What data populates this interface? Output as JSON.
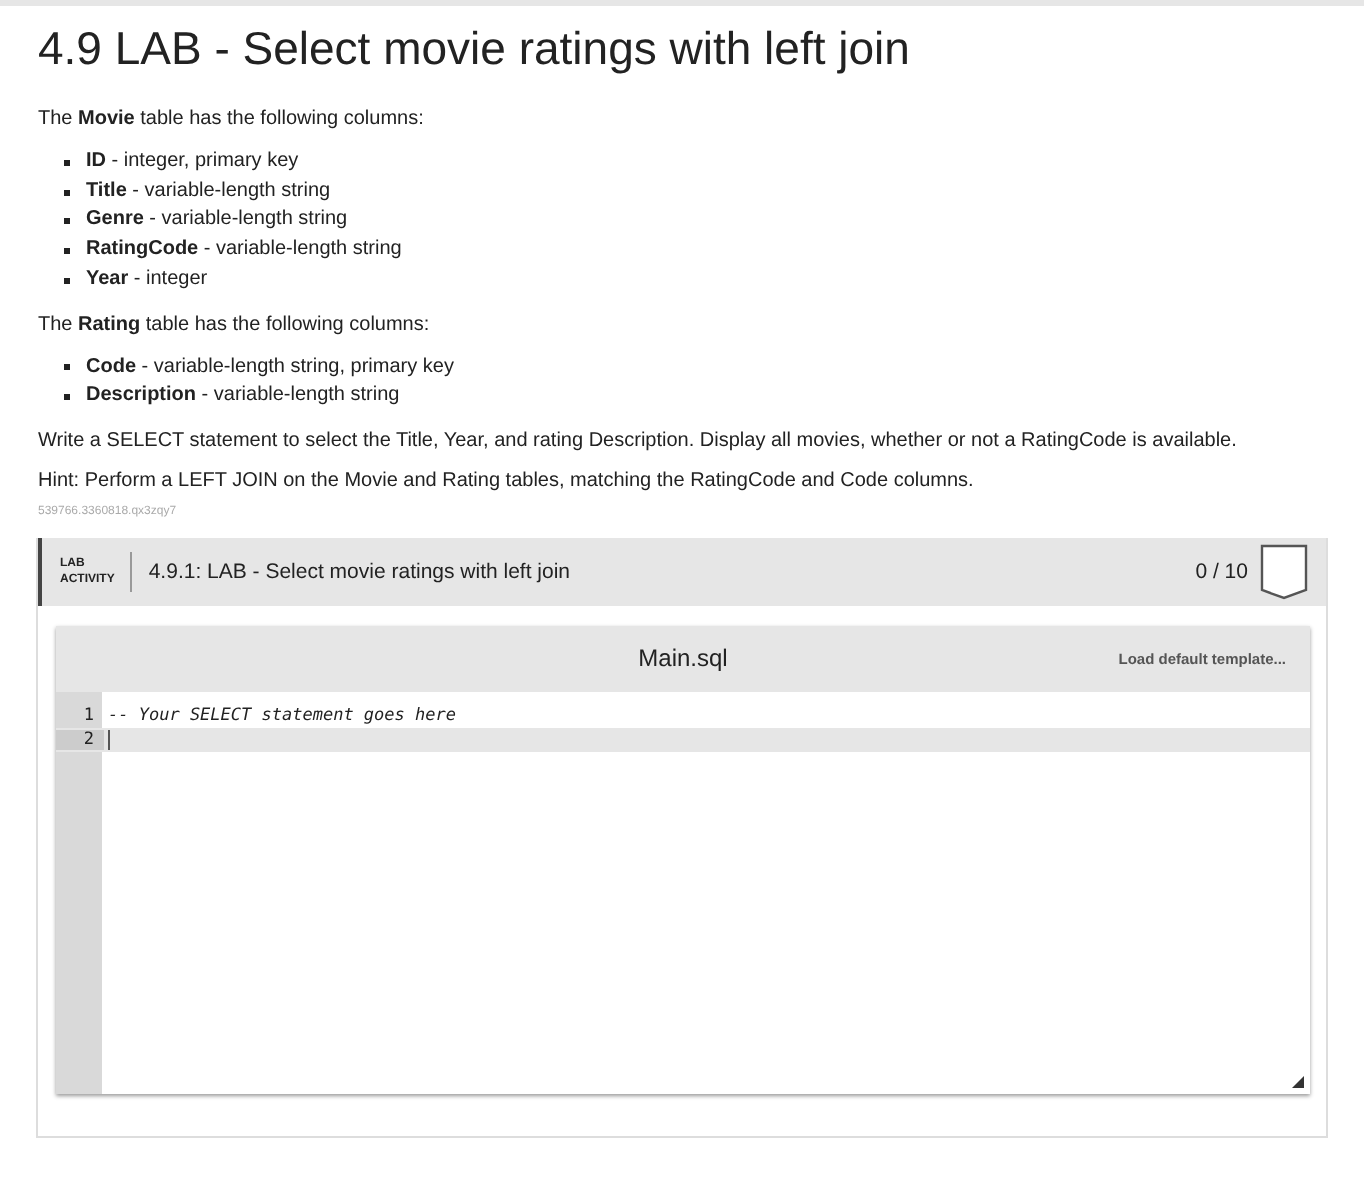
{
  "title": "4.9 LAB - Select movie ratings with left join",
  "sections": [
    {
      "intro": "The **Movie** table has the following columns:",
      "columns": [
        {
          "name": "ID",
          "description": " - integer, primary key"
        },
        {
          "name": "Title",
          "description": " - variable-length string"
        },
        {
          "name": "Genre",
          "description": " - variable-length string"
        },
        {
          "name": "RatingCode",
          "description": " - variable-length string"
        },
        {
          "name": "Year",
          "description": " - integer"
        }
      ]
    },
    {
      "intro": "The **Rating** table has the following columns:",
      "columns": [
        {
          "name": "Code",
          "description": " - variable-length string, primary key"
        },
        {
          "name": "Description",
          "description": " - variable-length string"
        }
      ]
    }
  ],
  "instructions": "Write a SELECT statement to select the Title, Year, and rating Description. Display all movies, whether or not a RatingCode is available.",
  "hint": "Hint: Perform a LEFT JOIN on the Movie and Rating tables, matching the RatingCode and Code columns.",
  "id_code": "539766.3360818.qx3zqy7",
  "activity": {
    "tag_line_1": "LAB",
    "tag_line_2": "ACTIVITY",
    "title": "4.9.1: LAB - Select movie ratings with left join",
    "score": "0 / 10"
  },
  "editor": {
    "filename": "Main.sql",
    "template_button": "Load default template...",
    "lines": [
      {
        "number": "1",
        "text": "-- Your SELECT statement goes here",
        "current": false
      },
      {
        "number": "2",
        "current": true
      }
    ]
  }
}
